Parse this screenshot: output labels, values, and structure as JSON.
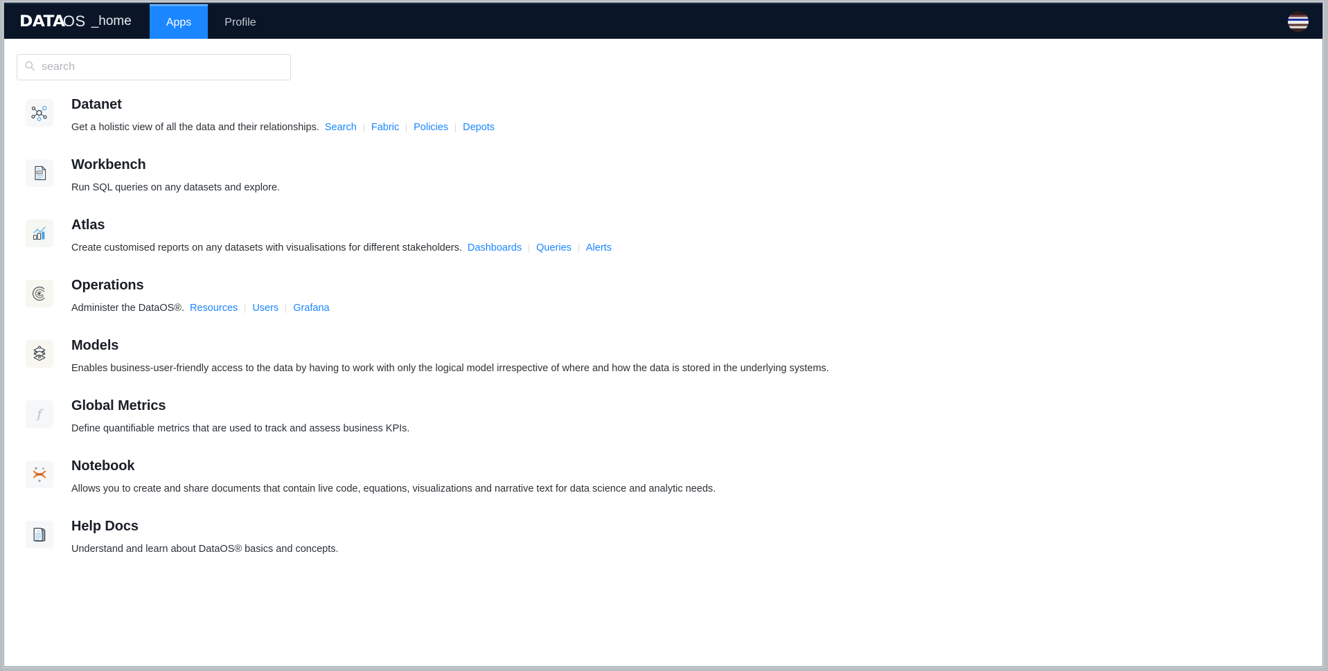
{
  "topbar": {
    "brand": {
      "data": "DATA",
      "os": "OS",
      "home": "_home"
    },
    "tabs": [
      {
        "label": "Apps",
        "active": true
      },
      {
        "label": "Profile",
        "active": false
      }
    ],
    "avatar_name": "user-avatar",
    "background_color": "#0a1628",
    "active_tab_color": "#1a86ff"
  },
  "search": {
    "placeholder": "search",
    "value": "",
    "icon": "search-icon"
  },
  "apps": [
    {
      "title": "Datanet",
      "icon": "network-graph-icon",
      "description": "Get a holistic view of all the data and their relationships.",
      "links": [
        "Search",
        "Fabric",
        "Policies",
        "Depots"
      ]
    },
    {
      "title": "Workbench",
      "icon": "sql-document-icon",
      "description": "Run SQL queries on any datasets and explore.",
      "links": []
    },
    {
      "title": "Atlas",
      "icon": "bar-chart-icon",
      "description": "Create customised reports on any datasets with visualisations for different stakeholders.",
      "links": [
        "Dashboards",
        "Queries",
        "Alerts"
      ]
    },
    {
      "title": "Operations",
      "icon": "radar-icon",
      "description": "Administer the DataOS®.",
      "links": [
        "Resources",
        "Users",
        "Grafana"
      ]
    },
    {
      "title": "Models",
      "icon": "layered-nodes-icon",
      "description": "Enables business-user-friendly access to the data by having to work with only the logical model irrespective of where and how the data is stored in the underlying systems.",
      "links": []
    },
    {
      "title": "Global Metrics",
      "icon": "function-f-icon",
      "description": "Define quantifiable metrics that are used to track and assess business KPIs.",
      "links": []
    },
    {
      "title": "Notebook",
      "icon": "jupyter-icon",
      "description": "Allows you to create and share documents that contain live code, equations, visualizations and narrative text for data science and analytic needs.",
      "links": []
    },
    {
      "title": "Help Docs",
      "icon": "help-document-icon",
      "description": "Understand and learn about DataOS® basics and concepts.",
      "links": []
    }
  ],
  "colors": {
    "link": "#1a86ff",
    "title": "#1a1f27",
    "text": "#2b3137",
    "nav_bg": "#0a1628"
  }
}
